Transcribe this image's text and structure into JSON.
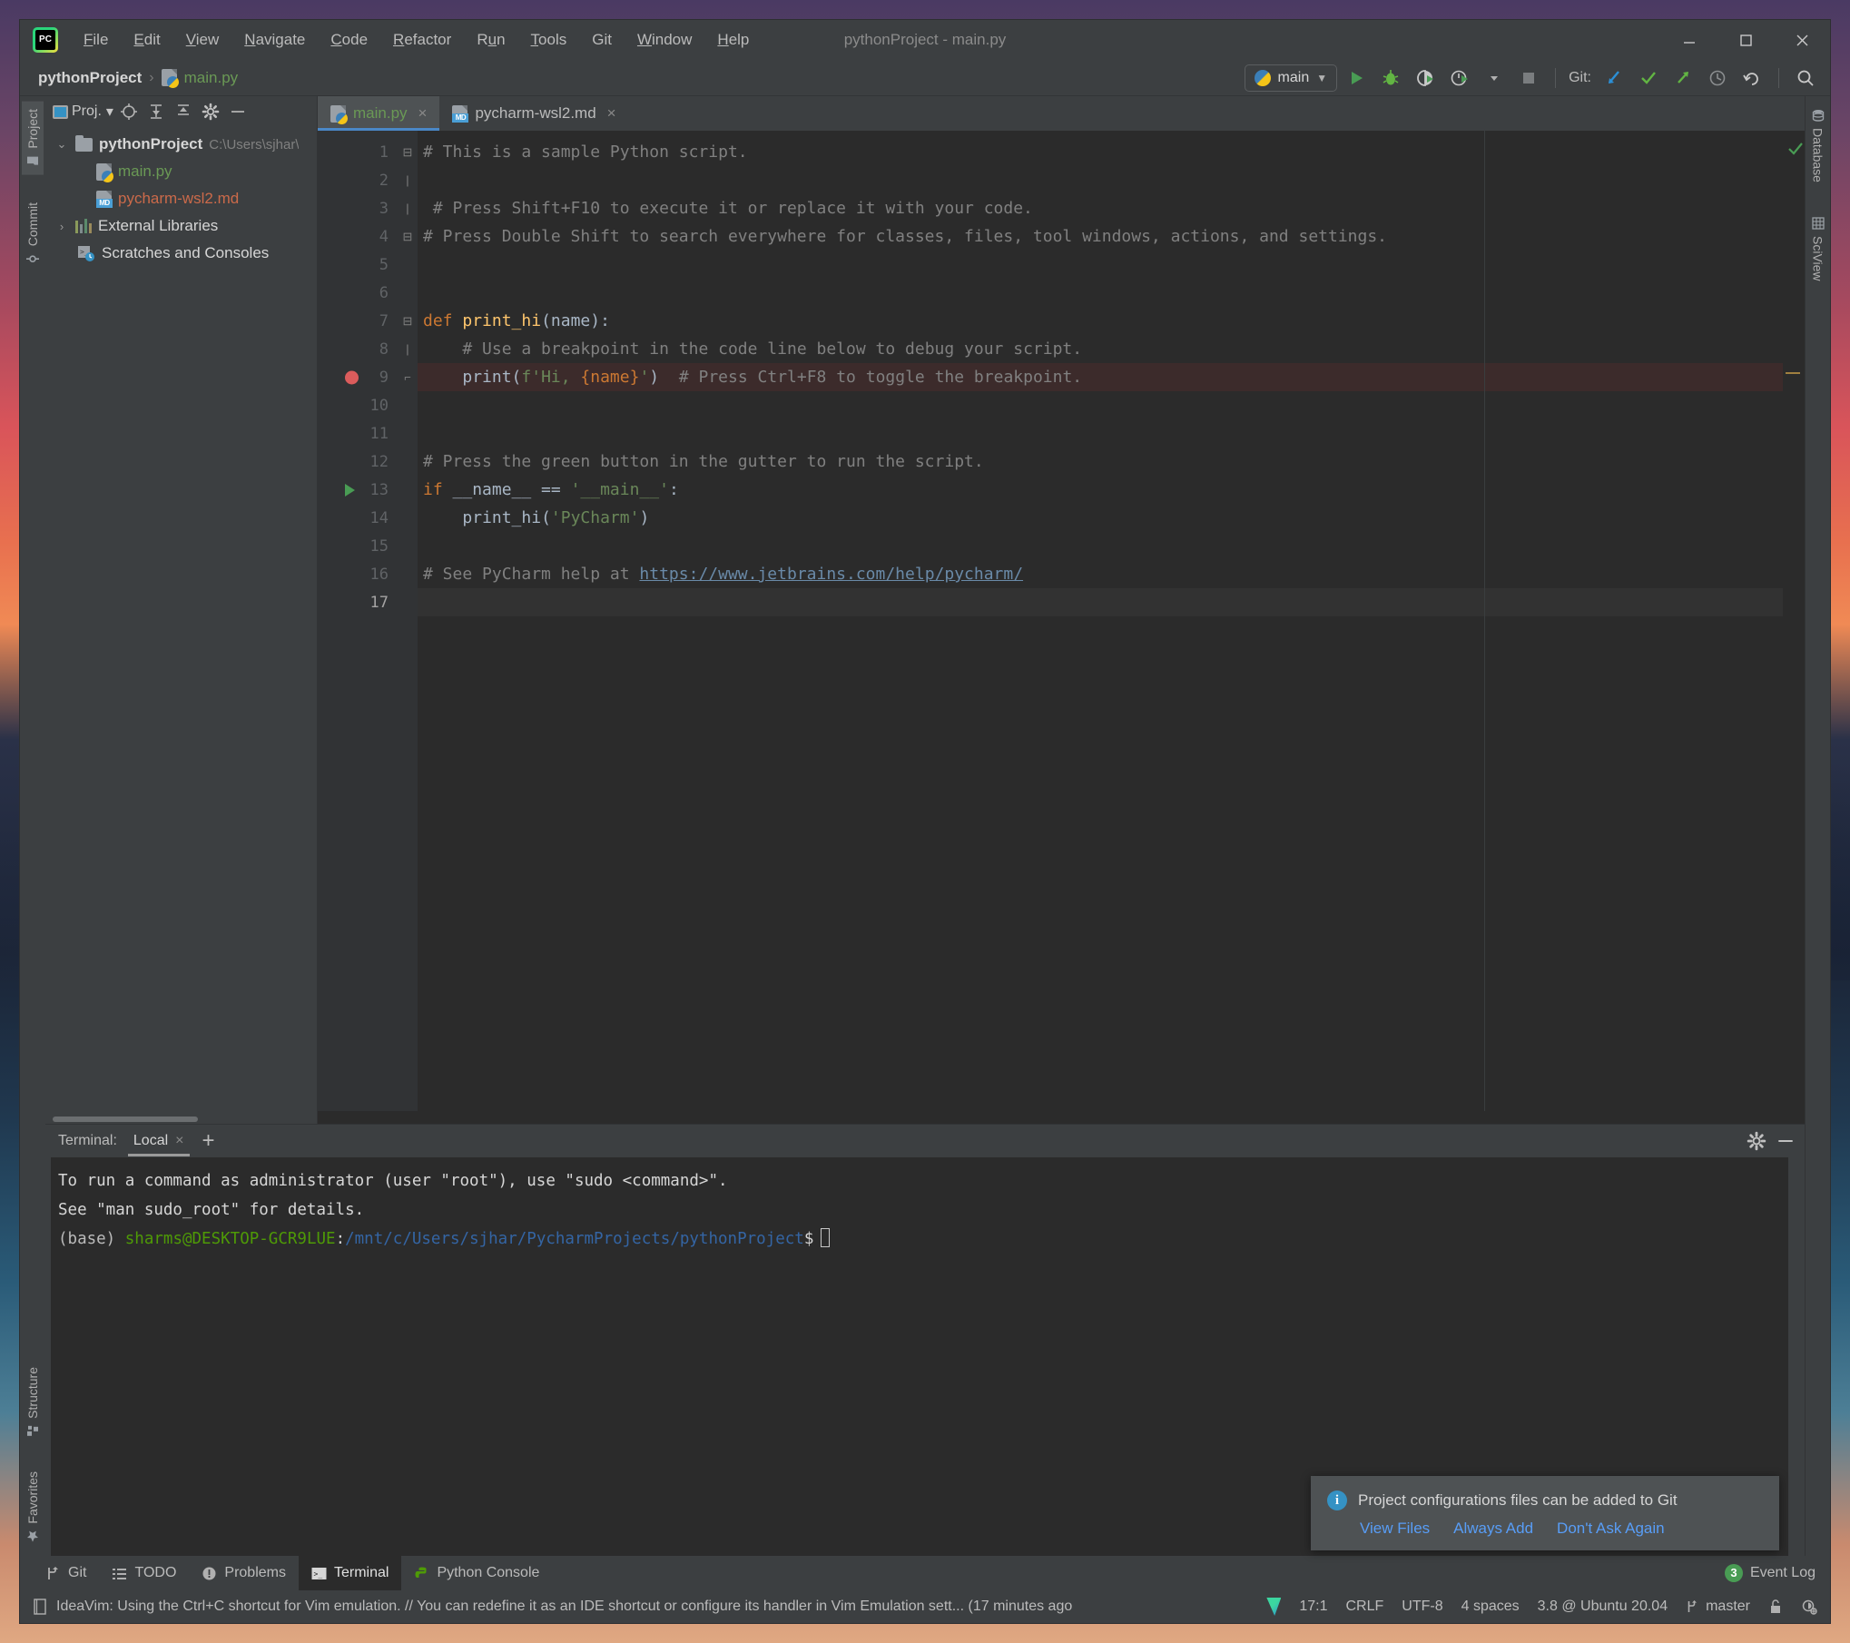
{
  "window": {
    "title": "pythonProject - main.py",
    "logo_icon": "pycharm-logo-icon",
    "minimize_icon": "minimize-icon",
    "maximize_icon": "maximize-icon",
    "close_icon": "close-icon"
  },
  "menu": {
    "items": [
      {
        "label": "File",
        "mnemonic": "F"
      },
      {
        "label": "Edit",
        "mnemonic": "E"
      },
      {
        "label": "View",
        "mnemonic": "V"
      },
      {
        "label": "Navigate",
        "mnemonic": "N"
      },
      {
        "label": "Code",
        "mnemonic": "C"
      },
      {
        "label": "Refactor",
        "mnemonic": "R"
      },
      {
        "label": "Run",
        "mnemonic": "u"
      },
      {
        "label": "Tools",
        "mnemonic": "T"
      },
      {
        "label": "Git",
        "mnemonic": ""
      },
      {
        "label": "Window",
        "mnemonic": "W"
      },
      {
        "label": "Help",
        "mnemonic": "H"
      }
    ]
  },
  "navbar": {
    "breadcrumb_project": "pythonProject",
    "breadcrumb_separator": "›",
    "breadcrumb_file": "main.py",
    "run_config": "main",
    "run_config_dropdown": "▼",
    "git_label": "Git:",
    "buttons": [
      {
        "name": "run-button",
        "icon": "play-icon"
      },
      {
        "name": "debug-button",
        "icon": "bug-icon"
      },
      {
        "name": "run-with-coverage-button",
        "icon": "coverage-icon"
      },
      {
        "name": "profile-button",
        "icon": "profiler-icon"
      },
      {
        "name": "run-options-dropdown",
        "icon": "chevron-down-icon"
      },
      {
        "name": "stop-button",
        "icon": "stop-icon"
      },
      {
        "name": "git-update-button",
        "icon": "update-project-icon"
      },
      {
        "name": "git-commit-button",
        "icon": "checkmark-icon"
      },
      {
        "name": "git-push-button",
        "icon": "push-icon"
      },
      {
        "name": "git-history-button",
        "icon": "history-icon"
      },
      {
        "name": "git-rollback-button",
        "icon": "rollback-icon"
      },
      {
        "name": "search-everywhere-button",
        "icon": "search-icon"
      }
    ]
  },
  "left_strip": {
    "top": [
      {
        "label": "Project",
        "icon": "folder-icon",
        "active": true
      },
      {
        "label": "Commit",
        "icon": "commit-icon",
        "active": false
      }
    ],
    "bottom": [
      {
        "label": "Structure",
        "icon": "structure-icon",
        "active": false
      },
      {
        "label": "Favorites",
        "icon": "star-icon",
        "active": false
      }
    ]
  },
  "right_strip": {
    "top": [
      {
        "label": "Database",
        "icon": "database-icon",
        "active": false
      },
      {
        "label": "SciView",
        "icon": "sciview-icon",
        "active": false
      }
    ]
  },
  "project_pane": {
    "title": "Proj.",
    "title_dropdown": "▾",
    "toolbar_icons": [
      "locate-icon",
      "expand-all-icon",
      "collapse-all-icon",
      "gear-icon",
      "hide-icon"
    ],
    "tree": [
      {
        "indent": 0,
        "arrow": "⌄",
        "icon": "folder-icon",
        "label": "pythonProject",
        "bold": true,
        "path": "C:\\Users\\sjhar\\",
        "color": "default"
      },
      {
        "indent": 1,
        "arrow": "",
        "icon": "python-file-icon",
        "label": "main.py",
        "bold": false,
        "path": "",
        "color": "python"
      },
      {
        "indent": 1,
        "arrow": "",
        "icon": "markdown-file-icon",
        "label": "pycharm-wsl2.md",
        "bold": false,
        "path": "",
        "color": "markdown"
      },
      {
        "indent": 0,
        "arrow": "›",
        "icon": "library-icon",
        "label": "External Libraries",
        "bold": false,
        "path": "",
        "color": "default"
      },
      {
        "indent": 0,
        "arrow": "",
        "icon": "scratches-icon",
        "label": "Scratches and Consoles",
        "bold": false,
        "path": "",
        "color": "default"
      }
    ]
  },
  "editor": {
    "tabs": [
      {
        "label": "main.py",
        "icon": "python-file-icon",
        "active": true,
        "closable": true,
        "close_glyph": "×"
      },
      {
        "label": "pycharm-wsl2.md",
        "icon": "markdown-file-icon",
        "active": false,
        "closable": true,
        "close_glyph": "×"
      }
    ],
    "lines": [
      {
        "n": "1",
        "gutter": "",
        "fold": "⊟",
        "highlight": "none"
      },
      {
        "n": "2",
        "gutter": "",
        "fold": "|",
        "highlight": "none"
      },
      {
        "n": "3",
        "gutter": "",
        "fold": "|",
        "highlight": "none"
      },
      {
        "n": "4",
        "gutter": "",
        "fold": "⊟",
        "highlight": "none"
      },
      {
        "n": "5",
        "gutter": "",
        "fold": "",
        "highlight": "none"
      },
      {
        "n": "6",
        "gutter": "",
        "fold": "",
        "highlight": "none"
      },
      {
        "n": "7",
        "gutter": "",
        "fold": "⊟",
        "highlight": "none"
      },
      {
        "n": "8",
        "gutter": "",
        "fold": "|",
        "highlight": "none"
      },
      {
        "n": "9",
        "gutter": "breakpoint",
        "fold": "⌐",
        "highlight": "breakpoint"
      },
      {
        "n": "10",
        "gutter": "",
        "fold": "",
        "highlight": "none"
      },
      {
        "n": "11",
        "gutter": "",
        "fold": "",
        "highlight": "none"
      },
      {
        "n": "12",
        "gutter": "",
        "fold": "",
        "highlight": "none"
      },
      {
        "n": "13",
        "gutter": "runarrow",
        "fold": "",
        "highlight": "none"
      },
      {
        "n": "14",
        "gutter": "",
        "fold": "",
        "highlight": "none"
      },
      {
        "n": "15",
        "gutter": "",
        "fold": "",
        "highlight": "none"
      },
      {
        "n": "16",
        "gutter": "",
        "fold": "",
        "highlight": "none"
      },
      {
        "n": "17",
        "gutter": "",
        "fold": "",
        "highlight": "caret"
      }
    ],
    "source": {
      "l1": "# This is a sample Python script.",
      "l3": "# Press Shift+F10 to execute it or replace it with your code.",
      "l4": "# Press Double Shift to search everywhere for classes, files, tool windows, actions, and settings.",
      "l7_kw": "def ",
      "l7_fn": "print_hi",
      "l7_rest": "(name):",
      "l8": "# Use a breakpoint in the code line below to debug your script.",
      "l9_call": "print",
      "l9_f": "f'Hi, ",
      "l9_name": "{name}",
      "l9_end": "'",
      "l9_cmt": "# Press Ctrl+F8 to toggle the breakpoint.",
      "l12": "# Press the green button in the gutter to run the script.",
      "l13_kw": "if ",
      "l13_id": "__name__ == ",
      "l13_str": "'__main__'",
      "l13_colon": ":",
      "l14_fn": "print_hi",
      "l14_str": "'PyCharm'",
      "l16_cmt": "# See PyCharm help at ",
      "l16_url": "https://www.jetbrains.com/help/pycharm/"
    },
    "inspection_status": "ok-checkmark-icon"
  },
  "terminal": {
    "label": "Terminal:",
    "tab": "Local",
    "tab_close": "×",
    "add_tab": "+",
    "settings_icon": "gear-icon",
    "hide_icon": "minimize-icon",
    "lines": [
      {
        "type": "plain",
        "text": "To run a command as administrator (user \"root\"), use \"sudo <command>\"."
      },
      {
        "type": "plain",
        "text": "See \"man sudo_root\" for details."
      }
    ],
    "prompt": {
      "env": "(base) ",
      "user_host": "sharms@DESKTOP-GCR9LUE",
      "colon": ":",
      "path": "/mnt/c/Users/sjhar/PycharmProjects/pythonProject",
      "sigil": "$"
    }
  },
  "notification": {
    "icon": "info-icon",
    "icon_glyph": "i",
    "message": "Project configurations files can be added to Git",
    "actions": [
      "View Files",
      "Always Add",
      "Don't Ask Again"
    ]
  },
  "bottom_toolwindows": {
    "items": [
      {
        "label": "Git",
        "icon": "git-branch-icon",
        "active": false
      },
      {
        "label": "TODO",
        "icon": "todo-list-icon",
        "active": false
      },
      {
        "label": "Problems",
        "icon": "problems-icon",
        "active": false
      },
      {
        "label": "Terminal",
        "icon": "terminal-icon",
        "active": true
      },
      {
        "label": "Python Console",
        "icon": "python-icon",
        "active": false
      }
    ],
    "event_log": {
      "label": "Event Log",
      "count": "3"
    }
  },
  "statusbar": {
    "message_icon": "notification-icon",
    "message": "IdeaVim: Using the Ctrl+C shortcut for Vim emulation. // You can redefine it as an IDE shortcut or configure its handler in Vim Emulation sett... (17 minutes ago",
    "vim_icon": "ideavim-icon",
    "caret_position": "17:1",
    "line_separator": "CRLF",
    "encoding": "UTF-8",
    "indent": "4 spaces",
    "interpreter": "3.8 @ Ubuntu 20.04",
    "branch_icon": "git-branch-icon",
    "branch": "master",
    "lock_icon": "lock-icon",
    "inspection_icon": "inspections-icon"
  },
  "colors": {
    "accent_blue": "#4a88c7",
    "python_green": "#6a9955",
    "markdown_orange": "#cb6a4a",
    "breakpoint_red": "#db5c5c",
    "run_green": "#499c54",
    "link_blue": "#589df6",
    "keyword_orange": "#cc7832",
    "string_green": "#6a8759",
    "function_yellow": "#ffc66d",
    "comment_gray": "#808080"
  }
}
